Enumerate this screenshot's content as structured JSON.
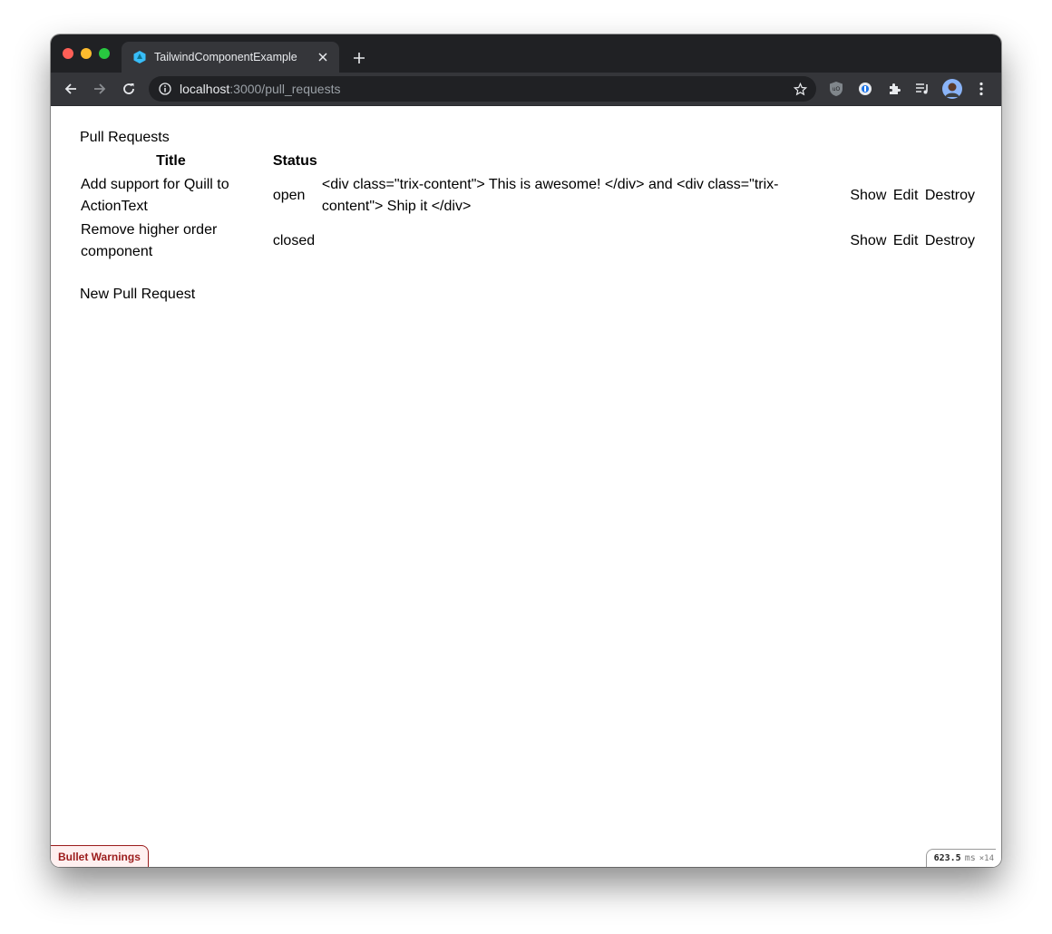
{
  "browser": {
    "tab_title": "TailwindComponentExample",
    "url_host": "localhost",
    "url_path": ":3000/pull_requests",
    "icons": {
      "back": "back-arrow-icon",
      "forward": "forward-arrow-icon",
      "reload": "reload-icon",
      "info": "info-icon",
      "star": "star-icon",
      "extensions": [
        "ublock-icon",
        "password-manager-icon",
        "puzzle-extensions-icon",
        "media-queue-icon",
        "profile-avatar",
        "kebab-menu-icon"
      ]
    }
  },
  "page": {
    "heading": "Pull Requests",
    "columns": {
      "title": "Title",
      "status": "Status"
    },
    "rows": [
      {
        "title": "Add support for Quill to ActionText",
        "status": "open",
        "body": "<div class=\"trix-content\"> This is awesome! </div> and <div class=\"trix-content\"> Ship it </div>",
        "show": "Show",
        "edit": "Edit",
        "destroy": "Destroy"
      },
      {
        "title": "Remove higher order component",
        "status": "closed",
        "body": "",
        "show": "Show",
        "edit": "Edit",
        "destroy": "Destroy"
      }
    ],
    "new_link": "New Pull Request"
  },
  "debug": {
    "bullet_label": "Bullet Warnings",
    "profiler_time": "623.5",
    "profiler_unit": "ms",
    "profiler_count": "×14"
  },
  "colors": {
    "chrome_dark": "#202124",
    "chrome_toolbar": "#35363a",
    "bullet_red": "#9b1c1c"
  }
}
